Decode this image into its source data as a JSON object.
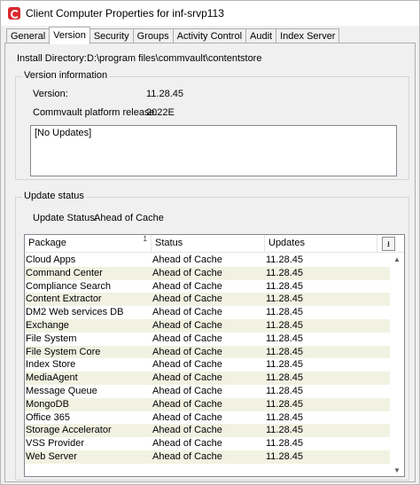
{
  "window": {
    "title": "Client Computer Properties for inf-srvp113"
  },
  "tabs": [
    {
      "label": "General"
    },
    {
      "label": "Version"
    },
    {
      "label": "Security"
    },
    {
      "label": "Groups"
    },
    {
      "label": "Activity Control"
    },
    {
      "label": "Audit"
    },
    {
      "label": "Index Server"
    }
  ],
  "active_tab": "Version",
  "install": {
    "label": "Install Directory:",
    "value": "D:\\program files\\commvault\\contentstore"
  },
  "version_info": {
    "title": "Version information",
    "version_label": "Version:",
    "version_value": "11.28.45",
    "platform_label": "Commvault platform release:",
    "platform_value": "2022E",
    "updates_text": "[No Updates]"
  },
  "update_status": {
    "title": "Update status",
    "status_label": "Update Status:",
    "status_value": "Ahead of Cache",
    "columns": [
      "Package",
      "Status",
      "Updates"
    ],
    "sort_marker": "1",
    "rows": [
      {
        "package": "Cloud Apps",
        "status": "Ahead of Cache",
        "updates": "11.28.45"
      },
      {
        "package": "Command Center",
        "status": "Ahead of Cache",
        "updates": "11.28.45"
      },
      {
        "package": "Compliance Search",
        "status": "Ahead of Cache",
        "updates": "11.28.45"
      },
      {
        "package": "Content Extractor",
        "status": "Ahead of Cache",
        "updates": "11.28.45"
      },
      {
        "package": "DM2 Web services DB",
        "status": "Ahead of Cache",
        "updates": "11.28.45"
      },
      {
        "package": "Exchange",
        "status": "Ahead of Cache",
        "updates": "11.28.45"
      },
      {
        "package": "File System",
        "status": "Ahead of Cache",
        "updates": "11.28.45"
      },
      {
        "package": "File System Core",
        "status": "Ahead of Cache",
        "updates": "11.28.45"
      },
      {
        "package": "Index Store",
        "status": "Ahead of Cache",
        "updates": "11.28.45"
      },
      {
        "package": "MediaAgent",
        "status": "Ahead of Cache",
        "updates": "11.28.45"
      },
      {
        "package": "Message Queue",
        "status": "Ahead of Cache",
        "updates": "11.28.45"
      },
      {
        "package": "MongoDB",
        "status": "Ahead of Cache",
        "updates": "11.28.45"
      },
      {
        "package": "Office 365",
        "status": "Ahead of Cache",
        "updates": "11.28.45"
      },
      {
        "package": "Storage Accelerator",
        "status": "Ahead of Cache",
        "updates": "11.28.45"
      },
      {
        "package": "VSS Provider",
        "status": "Ahead of Cache",
        "updates": "11.28.45"
      },
      {
        "package": "Web Server",
        "status": "Ahead of Cache",
        "updates": "11.28.45"
      }
    ]
  },
  "icons": {
    "app": "commvault-logo-icon",
    "filter": "column-chooser-icon",
    "sort": "sort-ascending-icon"
  },
  "colors": {
    "row_alt": "#f2f2e3",
    "brand": "#d9282f"
  }
}
